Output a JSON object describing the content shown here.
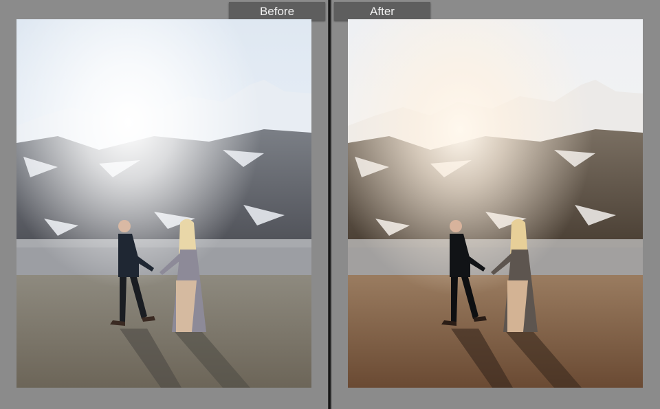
{
  "compare": {
    "before_label": "Before",
    "after_label": "After"
  },
  "colors": {
    "panel_background": "#8b8b8b",
    "tab_background": "#5e5e5e",
    "tab_text": "#f2f2f2",
    "divider": "#2d2d2d"
  }
}
